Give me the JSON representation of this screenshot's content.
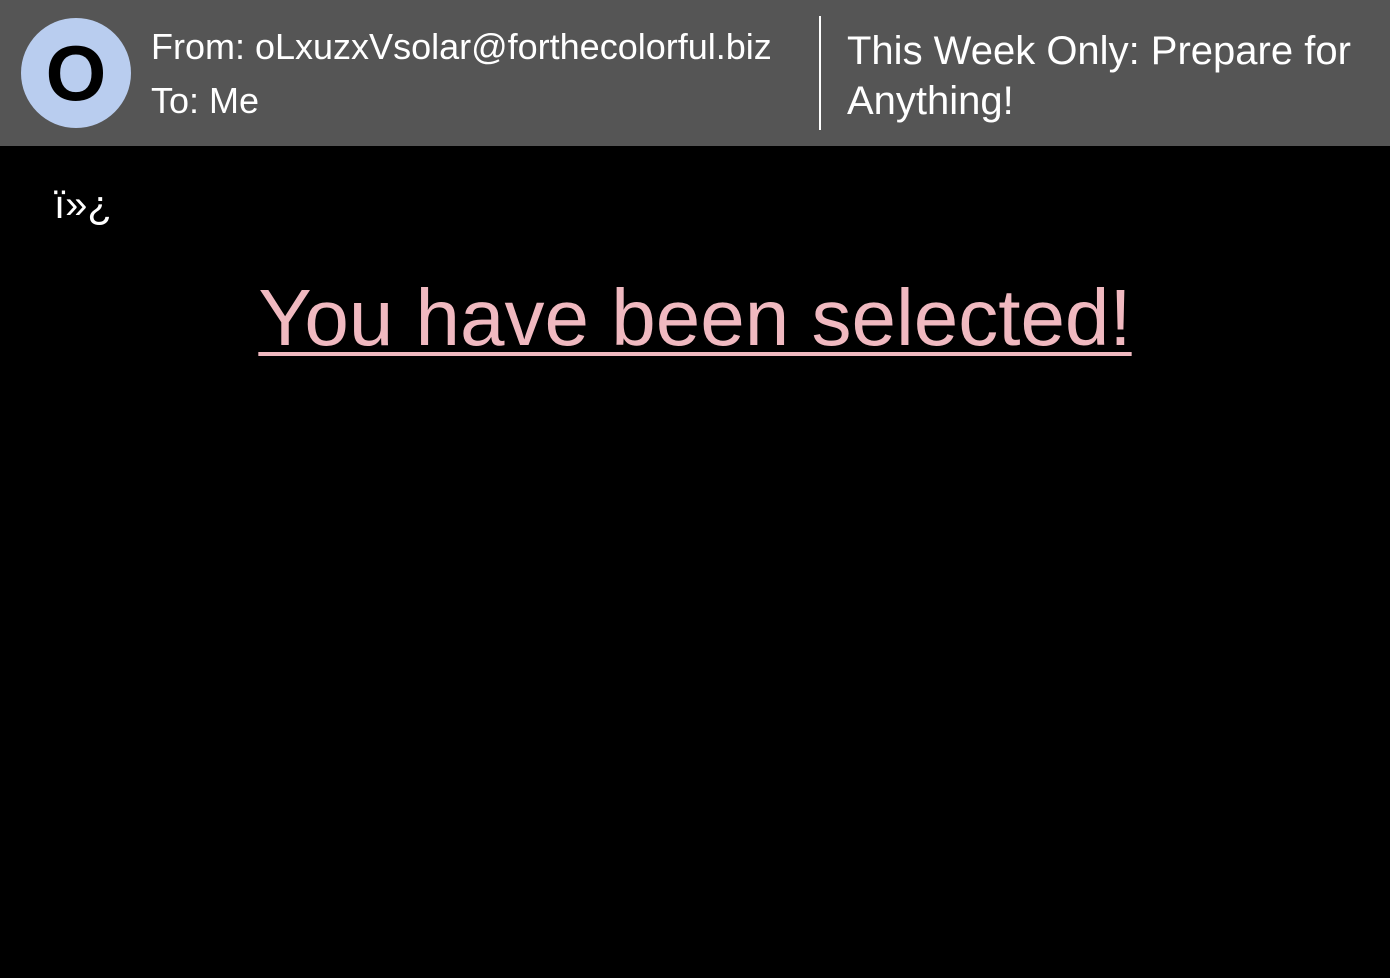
{
  "header": {
    "avatar_letter": "O",
    "from": "From: oLxuzxVsolar@forthecolorful.biz",
    "to": "To: Me",
    "subject": "This Week Only: Prepare for Anything!"
  },
  "body": {
    "bom_text": "ï»¿",
    "headline_link": "You have been selected!"
  },
  "colors": {
    "header_background": "#555555",
    "avatar_background": "#b9cdef",
    "body_background": "#000000",
    "link_color": "#f0b9c0",
    "text_color": "#ffffff"
  }
}
